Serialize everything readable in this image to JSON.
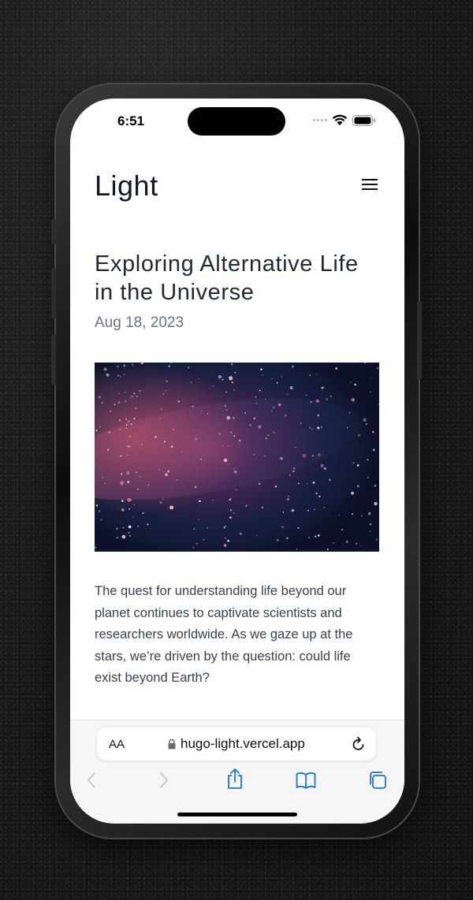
{
  "status_bar": {
    "time": "6:51"
  },
  "header": {
    "site_title": "Light"
  },
  "post": {
    "title": "Exploring Alternative Life in the Universe",
    "date": "Aug 18, 2023",
    "excerpt": "The quest for understanding life beyond our planet continues to captivate scientists and researchers worldwide. As we gaze up at the stars, we’re driven by the question: could life exist beyond Earth?"
  },
  "browser": {
    "text_size_label": "AA",
    "url": "hugo-light.vercel.app",
    "toolbar": [
      "back-icon",
      "forward-icon",
      "share-icon",
      "bookmarks-icon",
      "tabs-icon"
    ]
  },
  "colors": {
    "accent": "#1a73e8",
    "disabled": "#c7c7cc"
  }
}
